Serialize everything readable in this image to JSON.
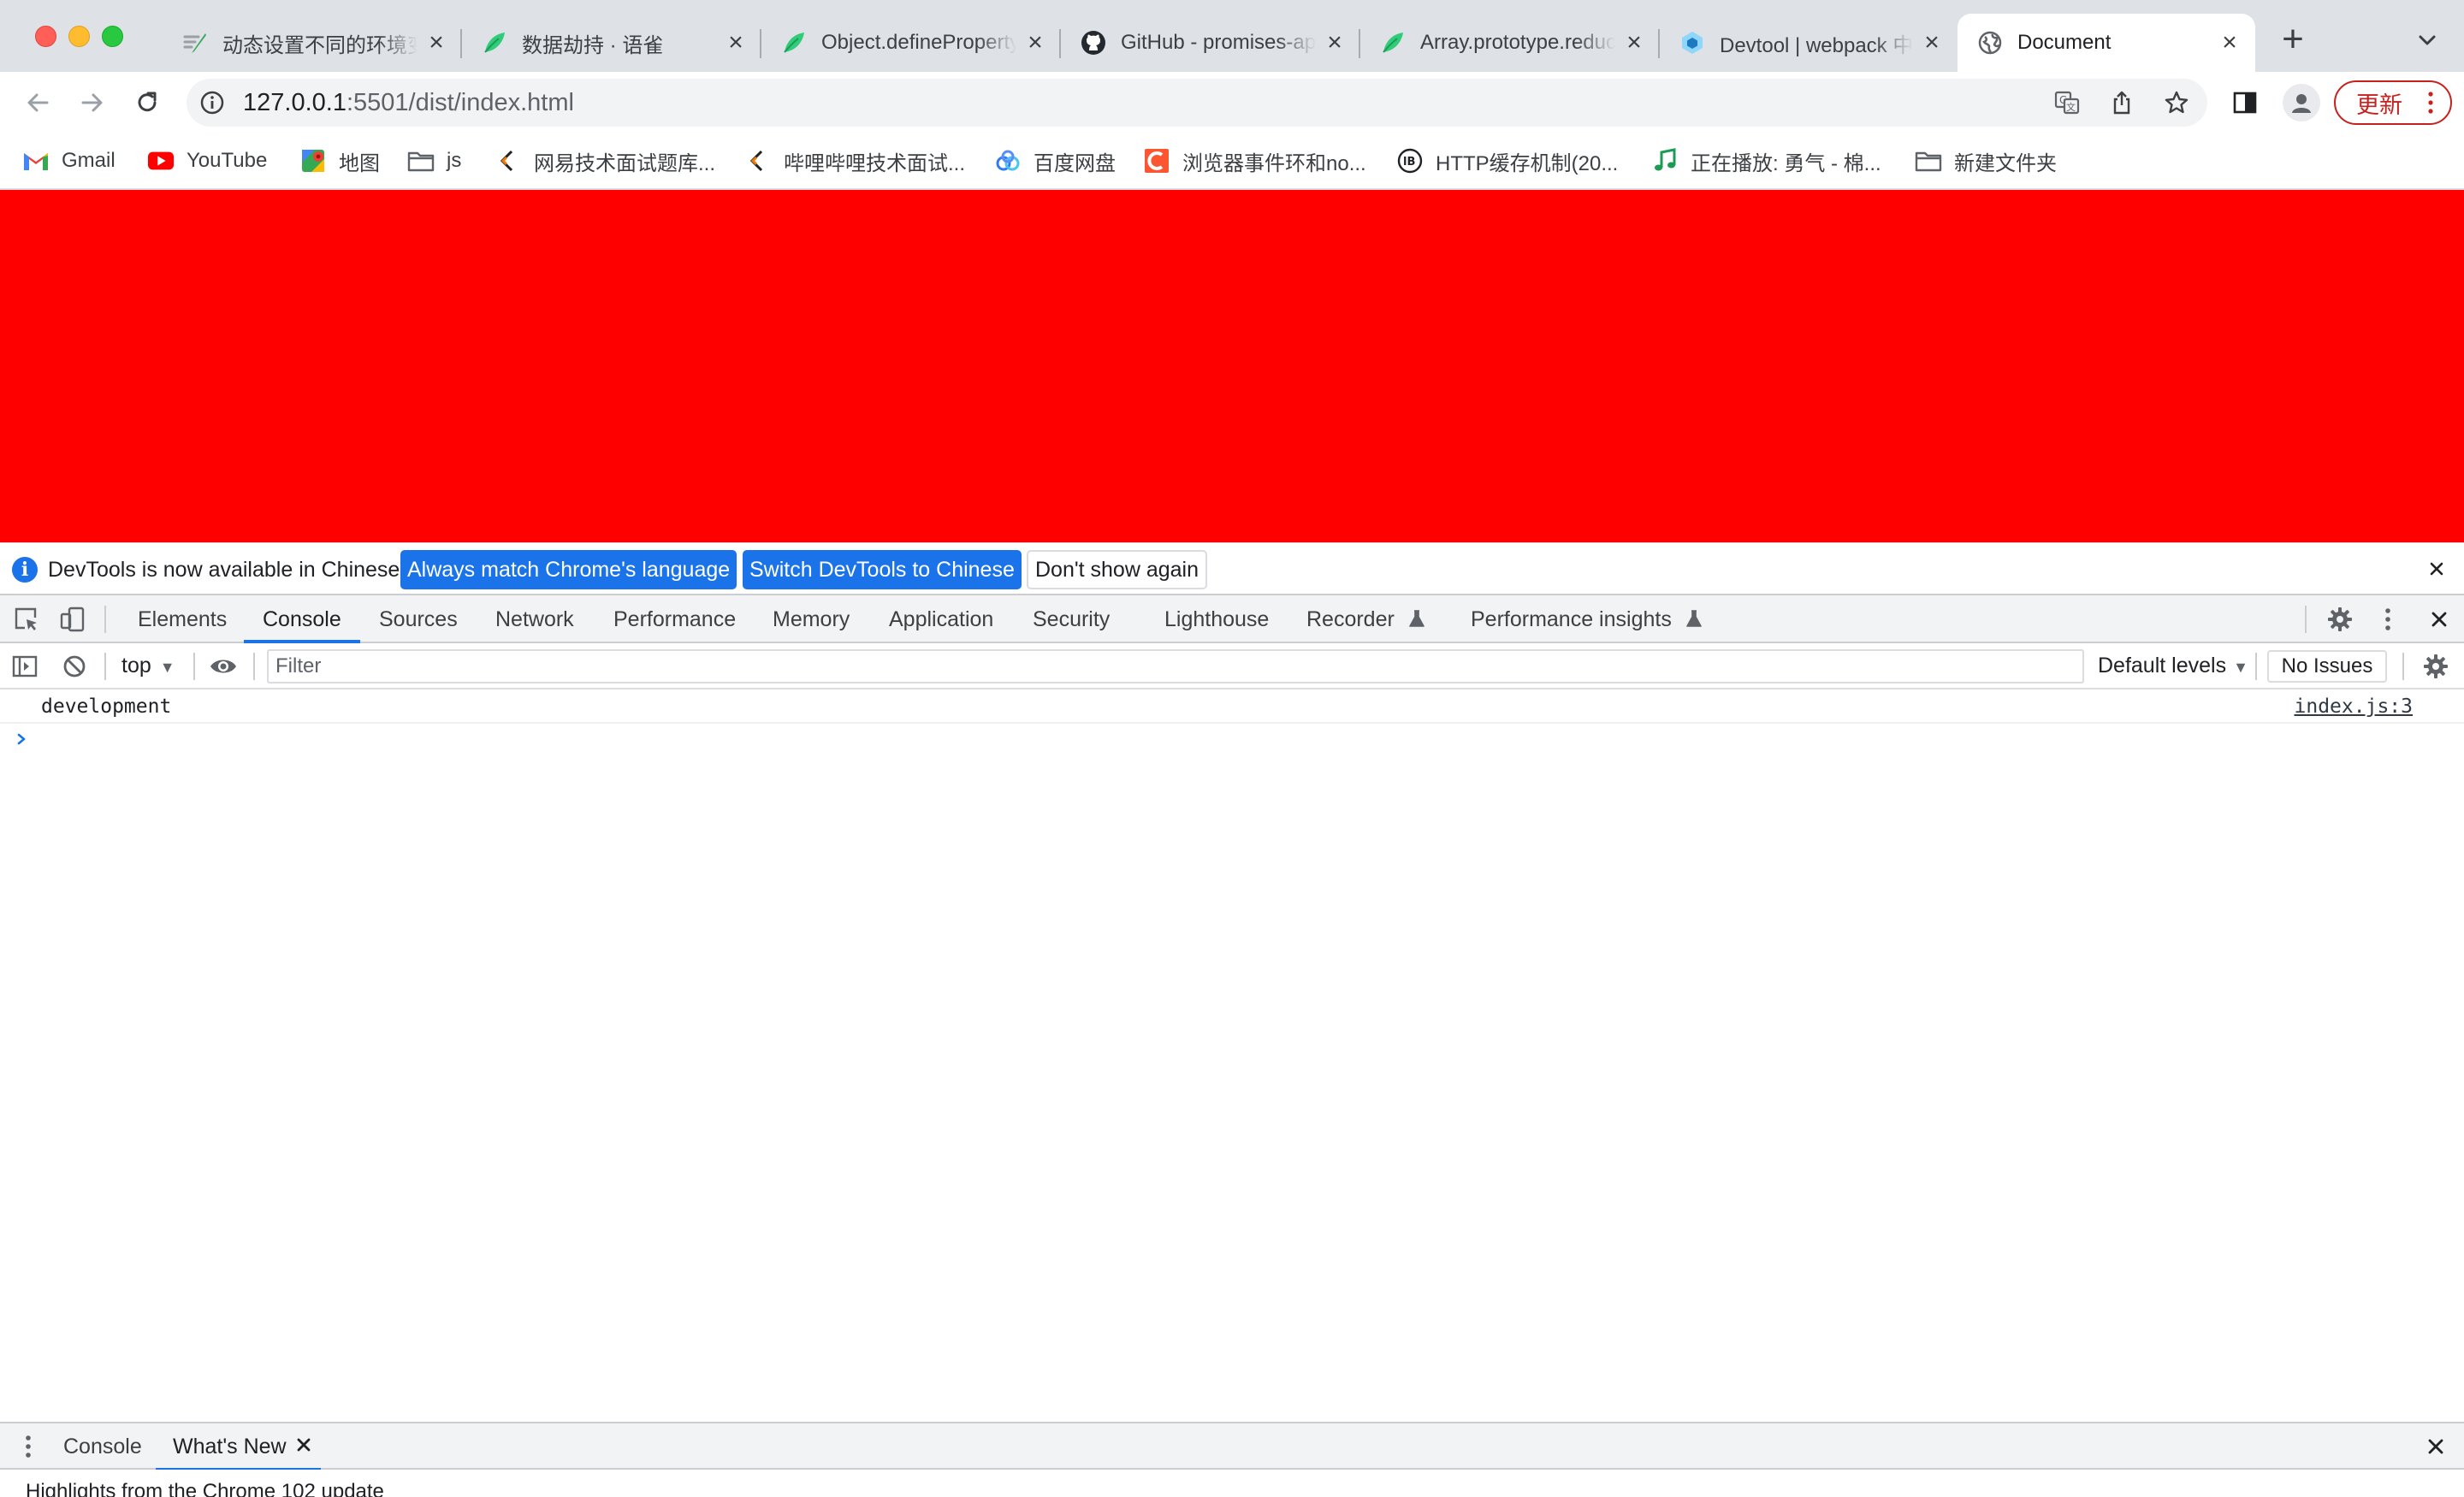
{
  "browser": {
    "tabs": [
      {
        "title": "动态设置不同的环境变量",
        "icon": "quill-icon"
      },
      {
        "title": "数据劫持 · 语雀",
        "icon": "yuque-icon"
      },
      {
        "title": "Object.defineProperty()",
        "icon": "yuque-icon"
      },
      {
        "title": "GitHub - promises-aplus",
        "icon": "github-icon"
      },
      {
        "title": "Array.prototype.reduce()",
        "icon": "yuque-icon"
      },
      {
        "title": "Devtool | webpack 中文",
        "icon": "webpack-icon"
      },
      {
        "title": "Document",
        "icon": "globe-icon",
        "active": true
      }
    ],
    "url_host": "127.0.0.1",
    "url_rest": ":5501/dist/index.html",
    "update_label": "更新",
    "bookmarks": [
      {
        "label": "Gmail",
        "icon": "gmail-icon"
      },
      {
        "label": "YouTube",
        "icon": "youtube-icon"
      },
      {
        "label": "地图",
        "icon": "maps-icon"
      },
      {
        "label": "js",
        "icon": "folder-icon"
      },
      {
        "label": "网易技术面试题库...",
        "icon": "netease-icon"
      },
      {
        "label": "哔哩哔哩技术面试...",
        "icon": "bilibili-icon"
      },
      {
        "label": "百度网盘",
        "icon": "baidu-pan-icon"
      },
      {
        "label": "浏览器事件环和no...",
        "icon": "csdn-icon"
      },
      {
        "label": "HTTP缓存机制(20...",
        "icon": "lb-icon"
      },
      {
        "label": "正在播放: 勇气 - 棉...",
        "icon": "music-icon"
      },
      {
        "label": "新建文件夹",
        "icon": "folder-icon"
      }
    ]
  },
  "page": {
    "background_color": "#ff0000"
  },
  "devtools": {
    "infobar": {
      "message": "DevTools is now available in Chinese!",
      "btn_match": "Always match Chrome's language",
      "btn_switch": "Switch DevTools to Chinese",
      "btn_dismiss": "Don't show again"
    },
    "tabs": [
      "Elements",
      "Console",
      "Sources",
      "Network",
      "Performance",
      "Memory",
      "Application",
      "Security",
      "Lighthouse",
      "Recorder",
      "Performance insights"
    ],
    "active_tab": "Console",
    "console": {
      "context": "top",
      "filter_placeholder": "Filter",
      "levels": "Default levels",
      "issues": "No Issues",
      "messages": [
        {
          "text": "development",
          "source": "index.js:3"
        }
      ]
    },
    "drawer": {
      "tabs": [
        "Console",
        "What's New"
      ],
      "active_tab": "What's New",
      "content": "Highlights from the Chrome 102 update"
    }
  },
  "colors": {
    "accent": "#1a73e8",
    "update": "#c5221f"
  }
}
